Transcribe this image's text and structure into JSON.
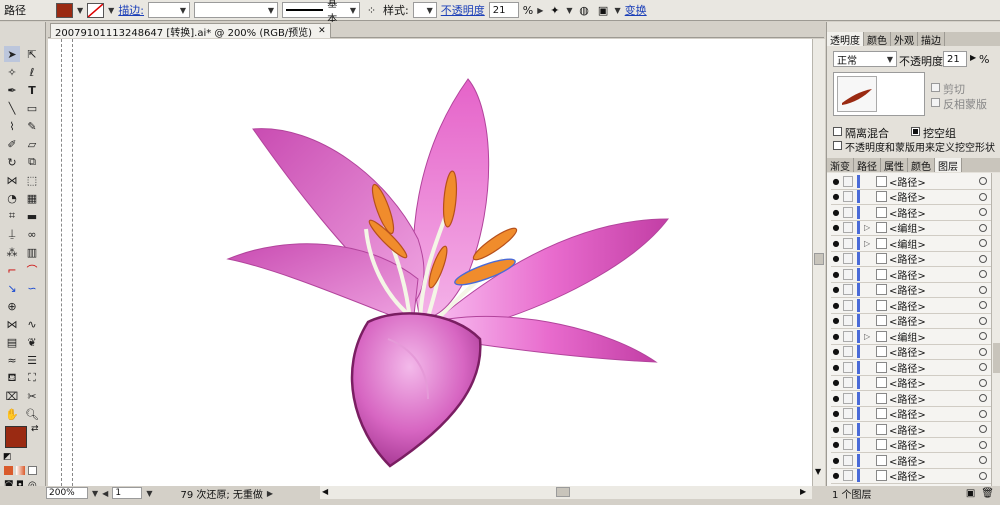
{
  "control_bar": {
    "object_type": "路径",
    "fill_color": "#9a2a12",
    "stroke_label": "描边:",
    "brush_label": "基本",
    "style_label": "样式:",
    "opacity_label": "不透明度",
    "opacity_value": "21",
    "percent": "%",
    "transform_label": "变换"
  },
  "document": {
    "tab_title": "20079101113248647 [转换].ai* @ 200% (RGB/预览)",
    "close_glyph": "✕"
  },
  "status_bar": {
    "zoom": "200%",
    "page": "1",
    "info": "79 次还原; 无重做"
  },
  "transparency_panel": {
    "tabs": [
      "透明度",
      "颜色",
      "外观",
      "描边"
    ],
    "blend_mode": "正常",
    "opacity_label": "不透明度:",
    "opacity_value": "21",
    "percent": "%",
    "clip_label": "剪切",
    "invert_mask_label": "反相蒙版",
    "isolate_label": "隔离混合",
    "knockout_label": "挖空组",
    "opacity_mask_label": "不透明度和蒙版用来定义挖空形状"
  },
  "layers_panel": {
    "tabs": [
      "渐变",
      "路径",
      "属性",
      "颜色",
      "图层"
    ],
    "rows": [
      {
        "name": "<路径>",
        "expandable": false
      },
      {
        "name": "<路径>",
        "expandable": false
      },
      {
        "name": "<路径>",
        "expandable": false
      },
      {
        "name": "<编组>",
        "expandable": true
      },
      {
        "name": "<编组>",
        "expandable": true
      },
      {
        "name": "<路径>",
        "expandable": false
      },
      {
        "name": "<路径>",
        "expandable": false
      },
      {
        "name": "<路径>",
        "expandable": false
      },
      {
        "name": "<路径>",
        "expandable": false
      },
      {
        "name": "<路径>",
        "expandable": false
      },
      {
        "name": "<编组>",
        "expandable": true
      },
      {
        "name": "<路径>",
        "expandable": false
      },
      {
        "name": "<路径>",
        "expandable": false
      },
      {
        "name": "<路径>",
        "expandable": false
      },
      {
        "name": "<路径>",
        "expandable": false
      },
      {
        "name": "<路径>",
        "expandable": false
      },
      {
        "name": "<路径>",
        "expandable": false
      },
      {
        "name": "<路径>",
        "expandable": false
      },
      {
        "name": "<路径>",
        "expandable": false
      },
      {
        "name": "<路径>",
        "expandable": false
      }
    ],
    "footer": "1 个图层"
  },
  "tool_colors": {
    "fill": "#9a2a12",
    "stroke": "#ffffff"
  },
  "flower_colors": {
    "petal_light": "#f7b8ee",
    "petal_mid": "#e563c9",
    "petal_dark": "#8c1e6e",
    "stamen": "#f08c2c",
    "pollen": "#d9591b"
  }
}
